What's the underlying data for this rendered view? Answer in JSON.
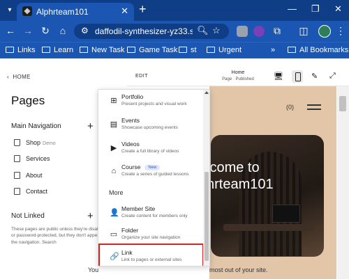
{
  "browser": {
    "tab": {
      "title": "Alphrteam101",
      "close": "✕"
    },
    "new_tab": "+",
    "window_controls": {
      "minimize": "—",
      "restore": "❐",
      "close": "✕"
    },
    "address": {
      "url": "daffodil-synthesizer-yz33.squ..."
    },
    "bookmarks": [
      {
        "label": "Links"
      },
      {
        "label": "Learn"
      },
      {
        "label": "New Task"
      },
      {
        "label": "Game Task"
      },
      {
        "label": "st"
      },
      {
        "label": "Urgent"
      }
    ],
    "bookmarks_overflow": "»",
    "all_bookmarks": "All Bookmarks"
  },
  "sidebar": {
    "back": "HOME",
    "title": "Pages",
    "main_nav": {
      "label": "Main Navigation",
      "items": [
        {
          "label": "Shop",
          "tag": "Demo"
        },
        {
          "label": "Services"
        },
        {
          "label": "About"
        },
        {
          "label": "Contact"
        }
      ]
    },
    "not_linked": {
      "label": "Not Linked",
      "note": "These pages are public unless they're disabled or password-protected, but they don't appear in the navigation. Search"
    }
  },
  "editor": {
    "edit": "EDIT",
    "page_name": "Home",
    "page_status": "Page · Published"
  },
  "preview": {
    "cart": "(0)",
    "hero_line1": "lcome to",
    "hero_line2": "hrteam101"
  },
  "footer": {
    "left": "You",
    "right": "most out of your site."
  },
  "dropdown": {
    "items": [
      {
        "icon": "⊞",
        "title": "Portfolio",
        "desc": "Present projects and visual work"
      },
      {
        "icon": "▤",
        "title": "Events",
        "desc": "Showcase upcoming events"
      },
      {
        "icon": "▶",
        "title": "Videos",
        "desc": "Create a full library of videos"
      },
      {
        "icon": "⌂",
        "title": "Course",
        "badge": "New",
        "desc": "Create a series of guided lessons"
      }
    ],
    "more_label": "More",
    "more_items": [
      {
        "icon": "👤",
        "title": "Member Site",
        "desc": "Create content for members only"
      },
      {
        "icon": "▭",
        "title": "Folder",
        "desc": "Organize your site navigation"
      },
      {
        "icon": "🔗",
        "title": "Link",
        "desc": "Link to pages or external sites"
      }
    ]
  },
  "colors": {
    "chrome_dark": "#0f3e86",
    "chrome": "#1a56b2",
    "preview_bg": "#e3c5a8",
    "highlight": "#e11d1d"
  }
}
